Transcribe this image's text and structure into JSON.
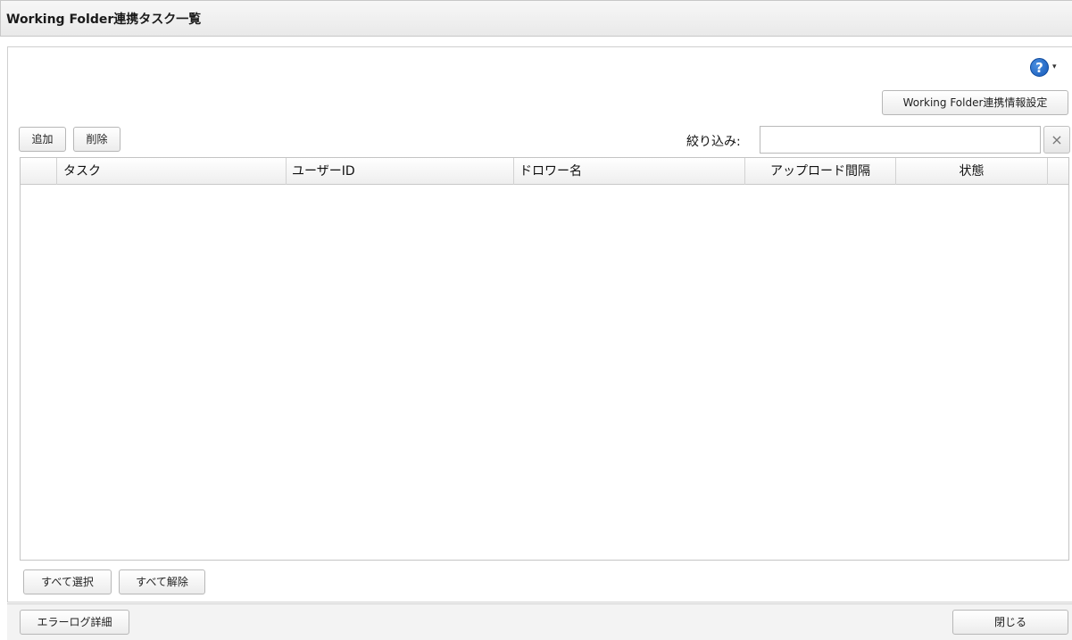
{
  "window": {
    "title": "Working Folder連携タスク一覧"
  },
  "toolbar": {
    "help_icon": "question-circle-icon",
    "help_symbol": "?",
    "help_caret": "▾",
    "settings_label": "Working Folder連携情報設定",
    "add_label": "追加",
    "delete_label": "削除"
  },
  "filter": {
    "label": "絞り込み:",
    "value": "",
    "clear_symbol": "×"
  },
  "table": {
    "columns": [
      "",
      "タスク",
      "ユーザーID",
      "ドロワー名",
      "アップロード間隔",
      "状態"
    ],
    "rows": []
  },
  "selection": {
    "select_all_label": "すべて選択",
    "deselect_all_label": "すべて解除"
  },
  "footer": {
    "error_log_label": "エラーログ詳細",
    "close_label": "閉じる"
  },
  "colors": {
    "help_icon": "#1558b8",
    "title_bar": "#ececec",
    "border": "#c4c4c4"
  }
}
